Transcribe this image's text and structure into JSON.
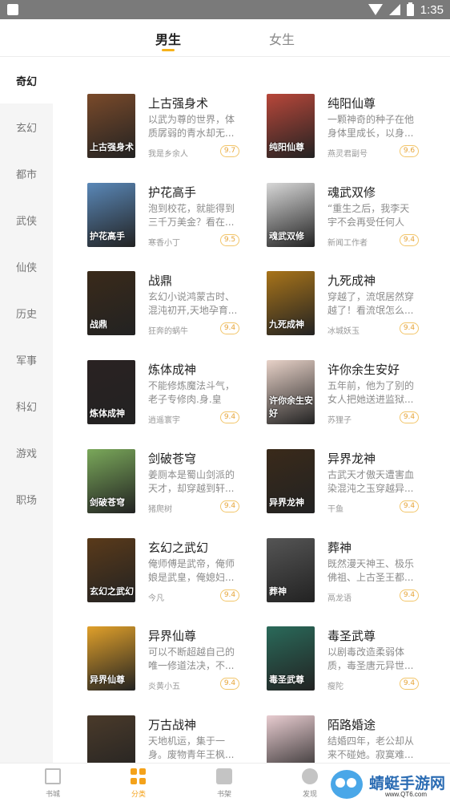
{
  "status_bar": {
    "time": "1:35"
  },
  "top_tabs": [
    {
      "label": "男生",
      "active": true
    },
    {
      "label": "女生",
      "active": false
    }
  ],
  "sidebar": {
    "items": [
      {
        "label": "奇幻",
        "active": true
      },
      {
        "label": "玄幻"
      },
      {
        "label": "都市"
      },
      {
        "label": "武侠"
      },
      {
        "label": "仙侠"
      },
      {
        "label": "历史"
      },
      {
        "label": "军事"
      },
      {
        "label": "科幻"
      },
      {
        "label": "游戏"
      },
      {
        "label": "职场"
      }
    ]
  },
  "books": [
    {
      "title": "上古强身术",
      "desc": "以武为尊的世界，体质孱弱的青水却无...",
      "author": "我是乡余人",
      "score": "9.7",
      "cover_text": "上古强身术",
      "cover_color": "#7a4a2a"
    },
    {
      "title": "纯阳仙尊",
      "desc": "一颗神奇的种子在他身体里成长，以身...",
      "author": "燕灵君副号",
      "score": "9.6",
      "cover_text": "纯阳仙尊",
      "cover_color": "#b8473a"
    },
    {
      "title": "护花高手",
      "desc": "泡到校花，就能得到三千万美金？看在...",
      "author": "寒香小丁",
      "score": "9.5",
      "cover_text": "护花高手",
      "cover_color": "#5a88b8"
    },
    {
      "title": "魂武双修",
      "desc": "“重生之后，我李天宇不会再受任何人的...",
      "author": "新闻工作者",
      "score": "9.4",
      "cover_text": "魂武双修",
      "cover_color": "#d8d8d8"
    },
    {
      "title": "战鼎",
      "desc": "玄幻小说鸿蒙古时、混沌初开,天地孕育...",
      "author": "狂奔的蜗牛",
      "score": "9.4",
      "cover_text": "战鼎",
      "cover_color": "#3a2a1a"
    },
    {
      "title": "九死成神",
      "desc": "穿越了，流氓居然穿越了！看流氓怎么...",
      "author": "冰城妖玉",
      "score": "9.4",
      "cover_text": "九死成神",
      "cover_color": "#a8741a"
    },
    {
      "title": "炼体成神",
      "desc": "不能修炼魔法斗气，老子专修肉.身.皇孙...",
      "author": "逍遥寰宇",
      "score": "9.4",
      "cover_text": "炼体成神",
      "cover_color": "#2a2222"
    },
    {
      "title": "许你余生安好",
      "desc": "五年前，他为了别的女人把她送进监狱...",
      "author": "苏狸子",
      "score": "9.4",
      "cover_text": "许你余生安好",
      "cover_color": "#e8d2c8"
    },
    {
      "title": "剑破苍穹",
      "desc": "姜厕本是蜀山剑派的天才，却穿越到轩...",
      "author": "猪爬树",
      "score": "9.4",
      "cover_text": "剑破苍穹",
      "cover_color": "#7aa85a"
    },
    {
      "title": "异界龙神",
      "desc": "古武天才傲天遭害血染混沌之玉穿越异...",
      "author": "干鱼",
      "score": "9.4",
      "cover_text": "异界龙神",
      "cover_color": "#3a2a1a"
    },
    {
      "title": "玄幻之武幻",
      "desc": "俺师傅是武帝，俺师娘是武皇，俺媳妇...",
      "author": "今凡",
      "score": "9.4",
      "cover_text": "玄幻之武幻",
      "cover_color": "#5a3a1a"
    },
    {
      "title": "葬神",
      "desc": "既然漫天神王、极乐佛祖、上古圣王都...",
      "author": "鬲龙语",
      "score": "9.4",
      "cover_text": "葬神",
      "cover_color": "#555555"
    },
    {
      "title": "异界仙尊",
      "desc": "可以不断超越自己的唯一修道法决，不...",
      "author": "炎黄小五",
      "score": "9.4",
      "cover_text": "异界仙尊",
      "cover_color": "#e0a02a"
    },
    {
      "title": "毒圣武尊",
      "desc": "以剧毒改造柔弱体质，毒圣唐元异世...",
      "author": "瘦陀",
      "score": "9.4",
      "cover_text": "毒圣武尊",
      "cover_color": "#2a6a5a"
    },
    {
      "title": "万古战神",
      "desc": "天地机运，集于一身。废物青年王枫...",
      "author": "",
      "score": "",
      "cover_text": "万古战神",
      "cover_color": "#4a3a2a"
    },
    {
      "title": "陌路婚途",
      "desc": "结婚四年，老公却从来不碰她。寂寞难...",
      "author": "",
      "score": "",
      "cover_text": "陌路婚途",
      "cover_color": "#e8ccd0"
    }
  ],
  "bottom_nav": [
    {
      "label": "书城",
      "icon": "book-icon",
      "active": false
    },
    {
      "label": "分类",
      "icon": "category-grid-icon",
      "active": true
    },
    {
      "label": "书架",
      "icon": "bookshelf-icon",
      "active": false
    },
    {
      "label": "发现",
      "icon": "planet-icon",
      "active": false
    }
  ],
  "watermark": {
    "text": "蜻蜓手游网",
    "url": "www.QT6.com"
  }
}
